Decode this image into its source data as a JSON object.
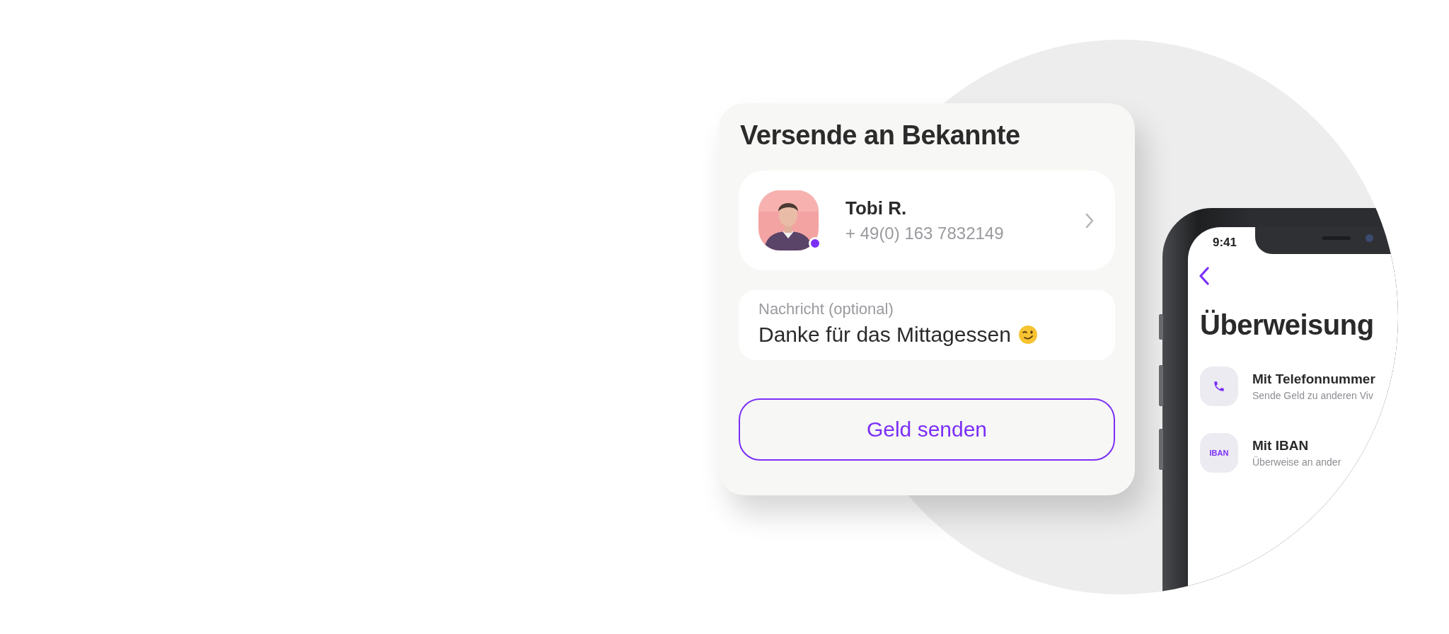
{
  "card": {
    "title": "Versende an Bekannte",
    "contact": {
      "name": "Tobi R.",
      "phone": "+ 49(0) 163 7832149",
      "online": true
    },
    "message": {
      "label": "Nachricht (optional)",
      "value": "Danke für das Mittagessen"
    },
    "button": "Geld senden"
  },
  "phone": {
    "status_time": "9:41",
    "title": "Überweisung",
    "options": [
      {
        "kind": "phone",
        "title": "Mit Telefonnummer",
        "subtitle": "Sende Geld zu anderen Viv"
      },
      {
        "kind": "iban",
        "icon_text": "IBAN",
        "title": "Mit IBAN",
        "subtitle": "Überweise an ander"
      }
    ]
  }
}
